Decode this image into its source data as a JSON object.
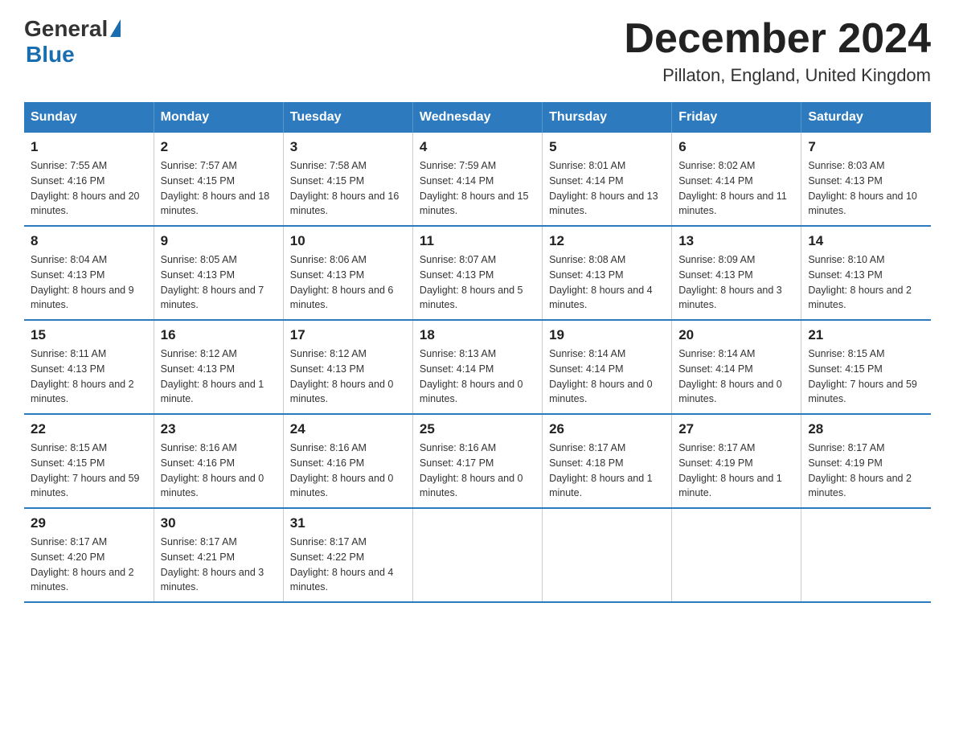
{
  "header": {
    "title": "December 2024",
    "location": "Pillaton, England, United Kingdom"
  },
  "logo": {
    "text_general": "General",
    "text_blue": "Blue"
  },
  "days_of_week": [
    "Sunday",
    "Monday",
    "Tuesday",
    "Wednesday",
    "Thursday",
    "Friday",
    "Saturday"
  ],
  "weeks": [
    [
      {
        "day": "1",
        "sunrise": "Sunrise: 7:55 AM",
        "sunset": "Sunset: 4:16 PM",
        "daylight": "Daylight: 8 hours and 20 minutes."
      },
      {
        "day": "2",
        "sunrise": "Sunrise: 7:57 AM",
        "sunset": "Sunset: 4:15 PM",
        "daylight": "Daylight: 8 hours and 18 minutes."
      },
      {
        "day": "3",
        "sunrise": "Sunrise: 7:58 AM",
        "sunset": "Sunset: 4:15 PM",
        "daylight": "Daylight: 8 hours and 16 minutes."
      },
      {
        "day": "4",
        "sunrise": "Sunrise: 7:59 AM",
        "sunset": "Sunset: 4:14 PM",
        "daylight": "Daylight: 8 hours and 15 minutes."
      },
      {
        "day": "5",
        "sunrise": "Sunrise: 8:01 AM",
        "sunset": "Sunset: 4:14 PM",
        "daylight": "Daylight: 8 hours and 13 minutes."
      },
      {
        "day": "6",
        "sunrise": "Sunrise: 8:02 AM",
        "sunset": "Sunset: 4:14 PM",
        "daylight": "Daylight: 8 hours and 11 minutes."
      },
      {
        "day": "7",
        "sunrise": "Sunrise: 8:03 AM",
        "sunset": "Sunset: 4:13 PM",
        "daylight": "Daylight: 8 hours and 10 minutes."
      }
    ],
    [
      {
        "day": "8",
        "sunrise": "Sunrise: 8:04 AM",
        "sunset": "Sunset: 4:13 PM",
        "daylight": "Daylight: 8 hours and 9 minutes."
      },
      {
        "day": "9",
        "sunrise": "Sunrise: 8:05 AM",
        "sunset": "Sunset: 4:13 PM",
        "daylight": "Daylight: 8 hours and 7 minutes."
      },
      {
        "day": "10",
        "sunrise": "Sunrise: 8:06 AM",
        "sunset": "Sunset: 4:13 PM",
        "daylight": "Daylight: 8 hours and 6 minutes."
      },
      {
        "day": "11",
        "sunrise": "Sunrise: 8:07 AM",
        "sunset": "Sunset: 4:13 PM",
        "daylight": "Daylight: 8 hours and 5 minutes."
      },
      {
        "day": "12",
        "sunrise": "Sunrise: 8:08 AM",
        "sunset": "Sunset: 4:13 PM",
        "daylight": "Daylight: 8 hours and 4 minutes."
      },
      {
        "day": "13",
        "sunrise": "Sunrise: 8:09 AM",
        "sunset": "Sunset: 4:13 PM",
        "daylight": "Daylight: 8 hours and 3 minutes."
      },
      {
        "day": "14",
        "sunrise": "Sunrise: 8:10 AM",
        "sunset": "Sunset: 4:13 PM",
        "daylight": "Daylight: 8 hours and 2 minutes."
      }
    ],
    [
      {
        "day": "15",
        "sunrise": "Sunrise: 8:11 AM",
        "sunset": "Sunset: 4:13 PM",
        "daylight": "Daylight: 8 hours and 2 minutes."
      },
      {
        "day": "16",
        "sunrise": "Sunrise: 8:12 AM",
        "sunset": "Sunset: 4:13 PM",
        "daylight": "Daylight: 8 hours and 1 minute."
      },
      {
        "day": "17",
        "sunrise": "Sunrise: 8:12 AM",
        "sunset": "Sunset: 4:13 PM",
        "daylight": "Daylight: 8 hours and 0 minutes."
      },
      {
        "day": "18",
        "sunrise": "Sunrise: 8:13 AM",
        "sunset": "Sunset: 4:14 PM",
        "daylight": "Daylight: 8 hours and 0 minutes."
      },
      {
        "day": "19",
        "sunrise": "Sunrise: 8:14 AM",
        "sunset": "Sunset: 4:14 PM",
        "daylight": "Daylight: 8 hours and 0 minutes."
      },
      {
        "day": "20",
        "sunrise": "Sunrise: 8:14 AM",
        "sunset": "Sunset: 4:14 PM",
        "daylight": "Daylight: 8 hours and 0 minutes."
      },
      {
        "day": "21",
        "sunrise": "Sunrise: 8:15 AM",
        "sunset": "Sunset: 4:15 PM",
        "daylight": "Daylight: 7 hours and 59 minutes."
      }
    ],
    [
      {
        "day": "22",
        "sunrise": "Sunrise: 8:15 AM",
        "sunset": "Sunset: 4:15 PM",
        "daylight": "Daylight: 7 hours and 59 minutes."
      },
      {
        "day": "23",
        "sunrise": "Sunrise: 8:16 AM",
        "sunset": "Sunset: 4:16 PM",
        "daylight": "Daylight: 8 hours and 0 minutes."
      },
      {
        "day": "24",
        "sunrise": "Sunrise: 8:16 AM",
        "sunset": "Sunset: 4:16 PM",
        "daylight": "Daylight: 8 hours and 0 minutes."
      },
      {
        "day": "25",
        "sunrise": "Sunrise: 8:16 AM",
        "sunset": "Sunset: 4:17 PM",
        "daylight": "Daylight: 8 hours and 0 minutes."
      },
      {
        "day": "26",
        "sunrise": "Sunrise: 8:17 AM",
        "sunset": "Sunset: 4:18 PM",
        "daylight": "Daylight: 8 hours and 1 minute."
      },
      {
        "day": "27",
        "sunrise": "Sunrise: 8:17 AM",
        "sunset": "Sunset: 4:19 PM",
        "daylight": "Daylight: 8 hours and 1 minute."
      },
      {
        "day": "28",
        "sunrise": "Sunrise: 8:17 AM",
        "sunset": "Sunset: 4:19 PM",
        "daylight": "Daylight: 8 hours and 2 minutes."
      }
    ],
    [
      {
        "day": "29",
        "sunrise": "Sunrise: 8:17 AM",
        "sunset": "Sunset: 4:20 PM",
        "daylight": "Daylight: 8 hours and 2 minutes."
      },
      {
        "day": "30",
        "sunrise": "Sunrise: 8:17 AM",
        "sunset": "Sunset: 4:21 PM",
        "daylight": "Daylight: 8 hours and 3 minutes."
      },
      {
        "day": "31",
        "sunrise": "Sunrise: 8:17 AM",
        "sunset": "Sunset: 4:22 PM",
        "daylight": "Daylight: 8 hours and 4 minutes."
      },
      {
        "day": "",
        "sunrise": "",
        "sunset": "",
        "daylight": ""
      },
      {
        "day": "",
        "sunrise": "",
        "sunset": "",
        "daylight": ""
      },
      {
        "day": "",
        "sunrise": "",
        "sunset": "",
        "daylight": ""
      },
      {
        "day": "",
        "sunrise": "",
        "sunset": "",
        "daylight": ""
      }
    ]
  ]
}
